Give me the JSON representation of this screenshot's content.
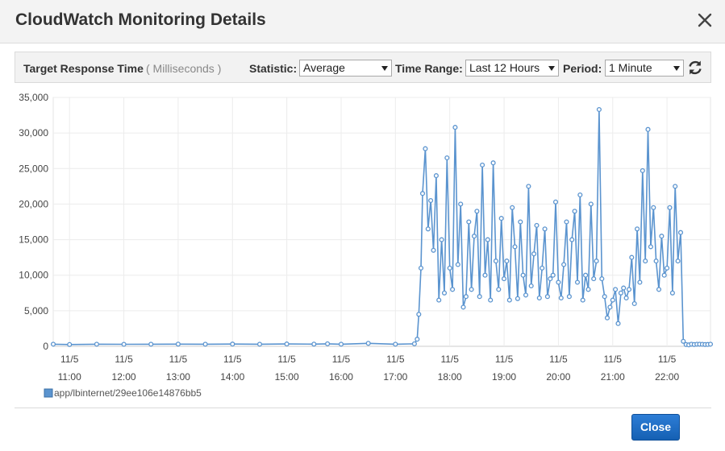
{
  "modal": {
    "title": "CloudWatch Monitoring Details",
    "close_button_label": "Close"
  },
  "toolbar": {
    "metric_name": "Target Response Time",
    "metric_unit": "( Milliseconds )",
    "statistic_label": "Statistic:",
    "statistic_value": "Average",
    "time_range_label": "Time Range:",
    "time_range_value": "Last 12 Hours",
    "period_label": "Period:",
    "period_value": "1 Minute"
  },
  "icons": {
    "close": "close-icon",
    "refresh": "refresh-icon"
  },
  "colors": {
    "series": "#5b94cf",
    "button": "#1a6cc4"
  },
  "chart_data": {
    "type": "line",
    "title": "",
    "xlabel": "",
    "ylabel": "",
    "ylim": [
      0,
      35000
    ],
    "yticks": [
      "0",
      "5,000",
      "10,000",
      "15,000",
      "20,000",
      "25,000",
      "30,000",
      "35,000"
    ],
    "xtick_times": [
      "11:00",
      "12:00",
      "13:00",
      "14:00",
      "15:00",
      "16:00",
      "17:00",
      "18:00",
      "19:00",
      "20:00",
      "21:00",
      "22:00"
    ],
    "xtick_dates": [
      "11/5",
      "11/5",
      "11/5",
      "11/5",
      "11/5",
      "11/5",
      "11/5",
      "11/5",
      "11/5",
      "11/5",
      "11/5",
      "11/5"
    ],
    "x_range_hours": [
      10.7,
      22.8
    ],
    "grid": true,
    "legend_position": "bottom-left",
    "series": [
      {
        "name": "app/lbinternet/29ee106e14876bb5",
        "x": [
          10.7,
          11.0,
          11.5,
          12.0,
          12.5,
          13.0,
          13.5,
          14.0,
          14.5,
          15.0,
          15.5,
          15.75,
          16.0,
          16.5,
          17.0,
          17.35,
          17.4,
          17.43,
          17.47,
          17.5,
          17.55,
          17.6,
          17.65,
          17.7,
          17.75,
          17.8,
          17.85,
          17.9,
          17.95,
          18.0,
          18.05,
          18.1,
          18.15,
          18.2,
          18.25,
          18.3,
          18.35,
          18.4,
          18.45,
          18.5,
          18.55,
          18.6,
          18.65,
          18.7,
          18.75,
          18.8,
          18.85,
          18.9,
          18.95,
          19.0,
          19.05,
          19.1,
          19.15,
          19.2,
          19.25,
          19.3,
          19.35,
          19.4,
          19.45,
          19.5,
          19.55,
          19.6,
          19.65,
          19.7,
          19.75,
          19.8,
          19.85,
          19.9,
          19.95,
          20.0,
          20.05,
          20.1,
          20.15,
          20.2,
          20.25,
          20.3,
          20.35,
          20.4,
          20.45,
          20.5,
          20.55,
          20.6,
          20.65,
          20.7,
          20.75,
          20.8,
          20.85,
          20.9,
          20.95,
          21.0,
          21.05,
          21.1,
          21.15,
          21.2,
          21.25,
          21.3,
          21.35,
          21.4,
          21.45,
          21.5,
          21.55,
          21.6,
          21.65,
          21.7,
          21.75,
          21.8,
          21.85,
          21.9,
          21.95,
          22.0,
          22.05,
          22.1,
          22.15,
          22.2,
          22.25,
          22.3,
          22.35,
          22.4,
          22.45,
          22.5,
          22.55,
          22.6,
          22.65,
          22.7,
          22.75,
          22.8
        ],
        "y": [
          300,
          250,
          300,
          280,
          300,
          310,
          300,
          320,
          290,
          330,
          310,
          350,
          300,
          420,
          300,
          350,
          1000,
          4500,
          11000,
          21500,
          27800,
          16500,
          20500,
          13500,
          24000,
          6500,
          15000,
          7500,
          26500,
          11000,
          8000,
          30800,
          11500,
          20000,
          5500,
          7000,
          17500,
          8000,
          15500,
          19000,
          7000,
          25500,
          10000,
          15000,
          6500,
          25800,
          12000,
          8000,
          18000,
          9500,
          12000,
          6500,
          19500,
          14000,
          6700,
          17500,
          10000,
          7200,
          22500,
          8500,
          13000,
          17000,
          6800,
          11000,
          16500,
          7000,
          9500,
          10000,
          20300,
          9000,
          6800,
          11500,
          17500,
          7000,
          15000,
          19000,
          9000,
          21300,
          6500,
          10000,
          8000,
          20000,
          9500,
          12000,
          33300,
          9500,
          7000,
          4000,
          5500,
          6500,
          8000,
          3200,
          7500,
          8200,
          6800,
          8000,
          12500,
          6000,
          16500,
          9000,
          24700,
          12000,
          30500,
          14000,
          19500,
          12000,
          8000,
          15500,
          10000,
          11000,
          19500,
          7500,
          22500,
          12000,
          16000,
          700,
          250,
          200,
          300,
          250,
          300,
          300,
          280,
          250,
          260,
          300
        ]
      }
    ]
  }
}
